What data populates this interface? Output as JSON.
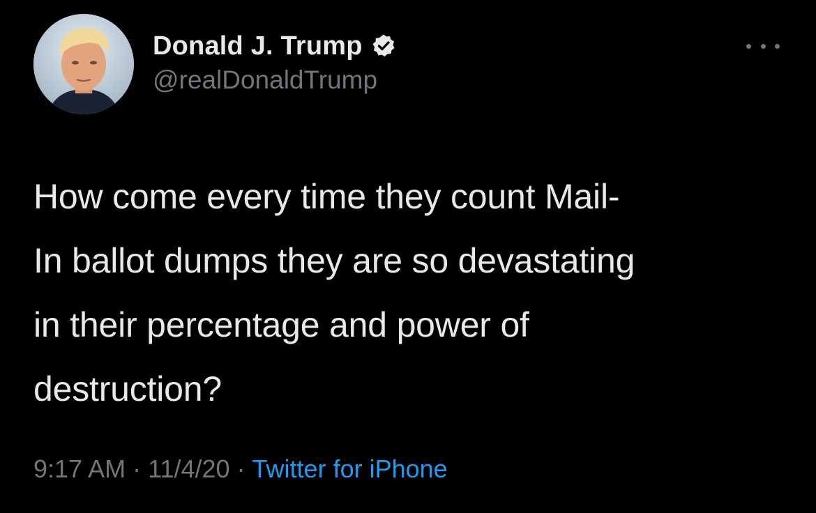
{
  "author": {
    "display_name": "Donald J. Trump",
    "handle": "@realDonaldTrump",
    "verified": true,
    "avatar_icon": "profile-photo"
  },
  "tweet": {
    "text": "How come every time they count Mail-\nIn ballot dumps they are so devastating\nin their percentage and power of\ndestruction?",
    "time": "9:17 AM",
    "separator": "·",
    "date": "11/4/20",
    "source": "Twitter for iPhone"
  },
  "icons": {
    "more": "more-options-icon",
    "verified": "verified-badge-icon"
  },
  "colors": {
    "background": "#000000",
    "primary_text": "#e7e9ea",
    "secondary_text": "#71767b",
    "link": "#1d9bf0"
  }
}
